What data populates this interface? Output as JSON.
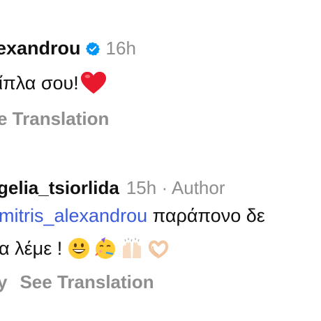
{
  "comment1": {
    "username": "exandrou",
    "time": "16h",
    "text": "ίπλα σου!",
    "see_translation": "e Translation"
  },
  "comment2": {
    "username": "gelia_tsiorlida",
    "time": "15h",
    "author_label": "Author",
    "mention": "mitris_alexandrou",
    "text_after_mention": " παράπονο δε",
    "text_line2": "α λέμε ! ",
    "reply_partial": "y",
    "see_translation": "See Translation"
  },
  "icons": {
    "verified": "verified-badge-icon",
    "heart": "red-heart-emoji",
    "emojis": [
      "grinning-face-emoji",
      "partying-face-emoji",
      "raising-hands-emoji",
      "heart-hands-emoji"
    ]
  },
  "colors": {
    "mention_link": "#3b5bdb",
    "secondary_text": "#8e8e8e",
    "verified_blue": "#0095f6",
    "heart_red": "#e8192c"
  }
}
